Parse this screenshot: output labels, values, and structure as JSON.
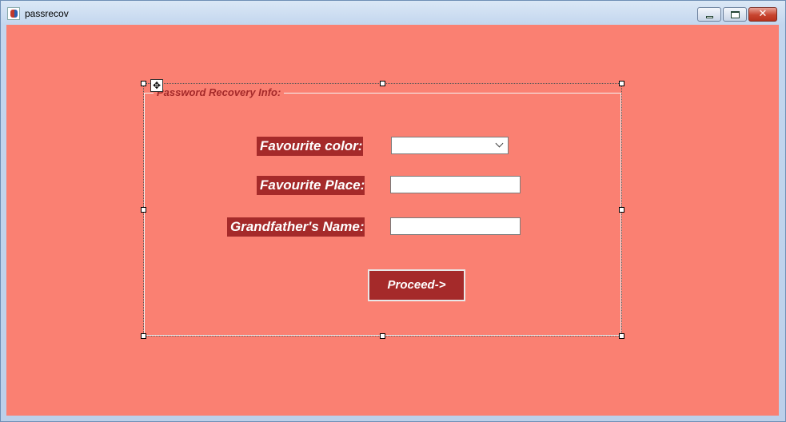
{
  "window": {
    "title": "passrecov",
    "minimize_glyph": "",
    "maximize_glyph": "",
    "close_glyph": "✕"
  },
  "form": {
    "group_title": "Password Recovery Info:",
    "fields": {
      "favourite_color": {
        "label": "Favourite color:",
        "value": ""
      },
      "favourite_place": {
        "label": "Favourite Place:",
        "value": "",
        "placeholder": ""
      },
      "grandfather_name": {
        "label": "Grandfather's Name:",
        "value": "",
        "placeholder": ""
      }
    },
    "proceed_label": "Proceed->",
    "move_glyph": "✥"
  },
  "colors": {
    "background": "#fa8072",
    "label_bg": "#a52a2a",
    "label_text": "#ffffff"
  },
  "icons": [
    "app-icon",
    "minimize-icon",
    "maximize-icon",
    "close-icon",
    "move-handle-icon",
    "chevron-down-icon"
  ]
}
